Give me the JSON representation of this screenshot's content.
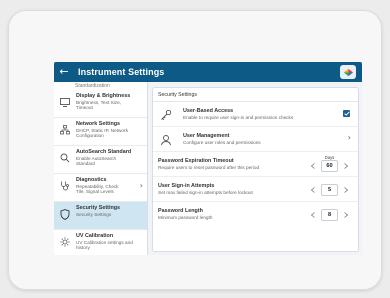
{
  "header": {
    "title": "Instrument Settings",
    "back_icon": "←"
  },
  "sidebar": {
    "cut_label": "Standardization",
    "items": [
      {
        "label": "Display & Brightness",
        "sub1": "Brightness, Text Size,",
        "sub2": "Timeout",
        "icon": "monitor-icon"
      },
      {
        "label": "Network Settings",
        "sub1": "DHCP, Static IP, Network",
        "sub2": "Configuration",
        "icon": "network-icon"
      },
      {
        "label": "AutoSearch Standard",
        "sub1": "Enable AutoSearch",
        "sub2": "Standard",
        "icon": "search-icon"
      },
      {
        "label": "Diagnostics",
        "sub1": "Repeatability, Check",
        "sub2": "Tile, Signal Levels",
        "icon": "stethoscope-icon"
      },
      {
        "label": "Security Settings",
        "sub1": "Security Settings",
        "sub2": "",
        "icon": "shield-icon"
      },
      {
        "label": "UV Calibration",
        "sub1": "UV Calibration settings and",
        "sub2": "history",
        "icon": "sun-icon"
      }
    ],
    "active_index": 4
  },
  "panel": {
    "title": "Security Settings",
    "rows": {
      "user_access": {
        "label": "User-Based Access",
        "sub": "Enable to require user sign-in and permission checks",
        "checked": true
      },
      "user_mgmt": {
        "label": "User Management",
        "sub": "Configure user roles and permissions"
      },
      "pwd_exp": {
        "label": "Password Expiration Timeout",
        "sub": "Require users to reset password after this period",
        "value": "60",
        "unit": "Days"
      },
      "signin": {
        "label": "User Sign-in Attempts",
        "sub": "Set max failed sign-in attempts before lockout",
        "value": "5"
      },
      "pwd_len": {
        "label": "Password Length",
        "sub": "Minimum password length",
        "value": "8"
      }
    }
  },
  "colors": {
    "header_bg": "#0d5a86",
    "active_item": "#cfe5f2",
    "checkbox": "#1f5f95"
  }
}
